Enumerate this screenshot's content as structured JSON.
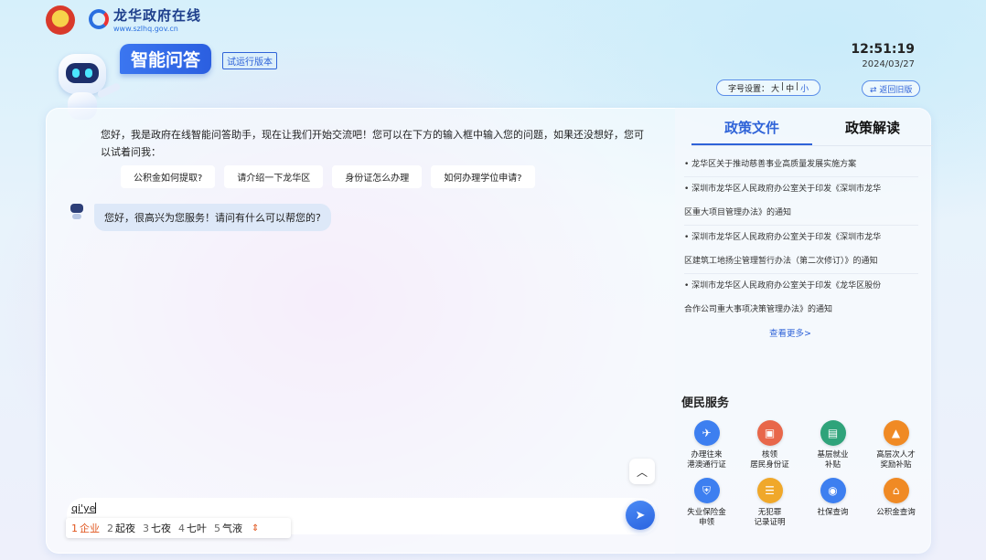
{
  "header": {
    "site_name": "龙华政府在线",
    "site_url": "www.szlhq.gov.cn",
    "app_title": "智能问答",
    "beta_label": "试运行版本",
    "time": "12:51:19",
    "date": "2024/03/27",
    "font_setting": {
      "label": "字号设置：",
      "options": [
        "大",
        "中",
        "小"
      ],
      "active": "小"
    },
    "back_old_label": "⇄ 返回旧版"
  },
  "chat": {
    "welcome": "您好，我是政府在线智能问答助手，现在让我们开始交流吧！您可以在下方的输入框中输入您的问题，如果还没想好，您可以试着问我：",
    "suggestions": [
      "公积金如何提取?",
      "请介绍一下龙华区",
      "身份证怎么办理",
      "如何办理学位申请?"
    ],
    "reply": "您好，很高兴为您服务！请问有什么可以帮您的?"
  },
  "input": {
    "typed": "qi'ye",
    "ime_candidates": [
      {
        "num": "1",
        "text": "企业"
      },
      {
        "num": "2",
        "text": "起夜"
      },
      {
        "num": "3",
        "text": "七夜"
      },
      {
        "num": "4",
        "text": "七叶"
      },
      {
        "num": "5",
        "text": "气液"
      }
    ]
  },
  "sidebar": {
    "tabs": [
      "政策文件",
      "政策解读"
    ],
    "active_tab": "政策文件",
    "policies": [
      "• 龙华区关于推动慈善事业高质量发展实施方案",
      "• 深圳市龙华区人民政府办公室关于印发《深圳市龙华",
      "区重大项目管理办法》的通知",
      "• 深圳市龙华区人民政府办公室关于印发《深圳市龙华",
      "区建筑工地扬尘管理暂行办法（第二次修订）》的通知",
      "• 深圳市龙华区人民政府办公室关于印发《龙华区股份",
      "合作公司重大事项决策管理办法》的通知"
    ],
    "more_label": "查看更多>",
    "services_title": "便民服务",
    "services": [
      {
        "label": "办理往来\n港澳通行证",
        "icon": "passport-icon",
        "color": "#3d7ff0"
      },
      {
        "label": "核领\n居民身份证",
        "icon": "id-card-icon",
        "color": "#e8674a"
      },
      {
        "label": "基层就业\n补贴",
        "icon": "briefcase-icon",
        "color": "#2fa37a"
      },
      {
        "label": "高层次人才\n奖励补贴",
        "icon": "graduation-icon",
        "color": "#f08a24"
      },
      {
        "label": "失业保险金\n申领",
        "icon": "insurance-icon",
        "color": "#3d7ff0"
      },
      {
        "label": "无犯罪\n记录证明",
        "icon": "certificate-icon",
        "color": "#f0a82a"
      },
      {
        "label": "社保查询",
        "icon": "social-security-icon",
        "color": "#3d7ff0"
      },
      {
        "label": "公积金查询",
        "icon": "housing-fund-icon",
        "color": "#f08a24"
      }
    ]
  },
  "colors": {
    "accent": "#2f63d8",
    "ime_selected": "#e0541c"
  }
}
